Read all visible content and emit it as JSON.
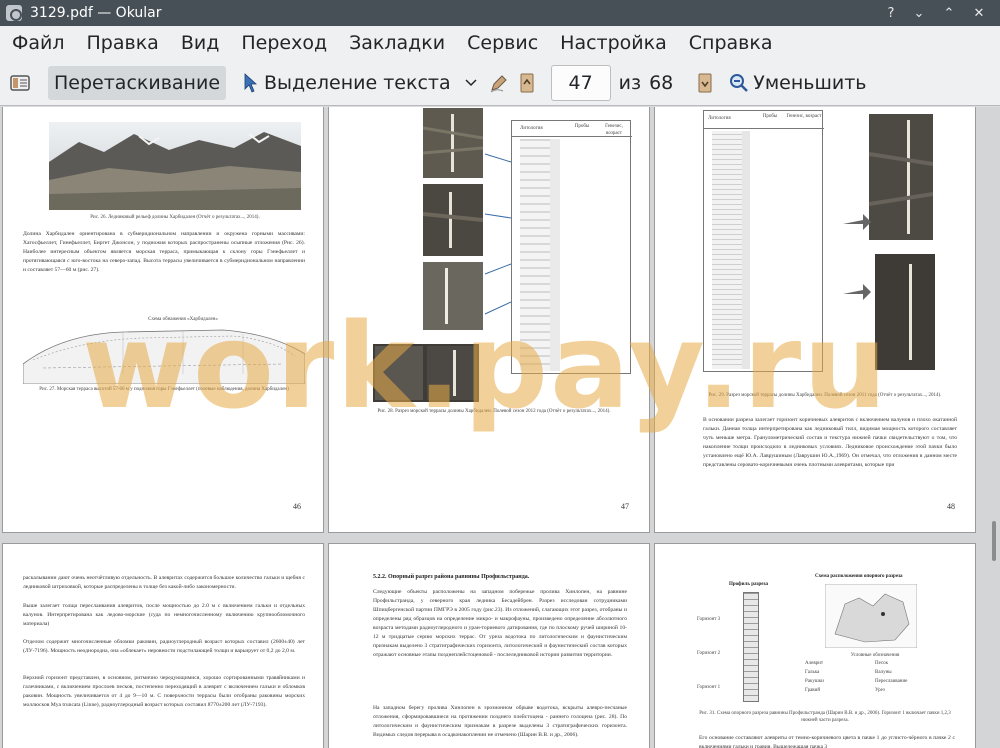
{
  "window": {
    "title": "3129.pdf — Okular",
    "controls": {
      "help": "?",
      "minimize": "⌄",
      "maximize": "⌃",
      "close": "✕"
    }
  },
  "menu": [
    "Файл",
    "Правка",
    "Вид",
    "Переход",
    "Закладки",
    "Сервис",
    "Настройка",
    "Справка"
  ],
  "toolbar": {
    "drag_label": "Перетаскивание",
    "select_label": "Выделение текста",
    "page_current": "47",
    "page_of": "из",
    "page_total": "68",
    "zoom_out_label": "Уменьшить"
  },
  "watermark": "work.pay.ru",
  "pages": {
    "p46": {
      "number": "46",
      "caption1": "Рис. 26. Ледниковый рельеф долины Харбидален (Отчёт о результатах..., 2014).",
      "body": "Долина Харбидален ориентирована в субмеридиональном направлении и окружена горными массивами: Хатосфьеллет, Гинефьеллет, Биргет Джонсон, у подножия которых распространены осыпные отложения (Рис. 26). Наиболее интересным объектом является морская терраса, примыкающая к склону горы Гэнефьеллет и протягивающаяся с юго-востока на северо-запад. Высота террасы увеличивается в субмеридиональном направлении и составляет 57—60 м (рис. 27).",
      "scheme_title": "Схема обнажения «Харбидален»",
      "caption2": "Рис. 27. Морская терраса высотой 57-60 м у подножия горы Гэнефьеллет (полевые наблюдения, долина Харбидален)"
    },
    "p47": {
      "number": "47",
      "col_lithology": "Литология",
      "col_samples": "Пробы",
      "col_genesis": "Генезис, возраст",
      "caption": "Рис. 28. Разрез морской террасы долины Харбидален. Полевой сезон 2012 года (Отчёт о результатах..., 2014)."
    },
    "p48": {
      "number": "48",
      "col_lithology": "Литология",
      "col_samples": "Пробы",
      "col_genesis": "Генезис, возраст",
      "caption": "Рис. 29. Разрез морской террасы долины Харбидален. Полевой сезон 2011 года (Отчёт о результатах..., 2014).",
      "body": "В основании разреза залегает горизонт коричневых алевритов с включением валунов и плохо окатанной гальки. Данная толща интерпретирована как ледниковый тилл, видимая мощность которого составляет чуть меньше метра. Гранулометрический состав и текстура нижней пачки свидетельствуют о том, что накопление толщи происходило в ледниковых условиях. Ледниковое происхождение этой пачки было установлено ещё Ю.А. Лаврушиным (Лаврушин Ю.А.,1969). Он отмечал, что отложения в данном месте представлены серовато-коричневыми очень плотными алевритами, которые при"
    },
    "p49": {
      "body1": "раскалывании дают очень неотчётливую отдельность. В алевритах содержится большое количество гальки и щебня с ледниковой штриховкой, которые распределены в толще без какой-либо закономерности.",
      "body2": "Выше залегает толща переслаивания алевритов, после мощностью до 2.0 м с включением гальки и отдельных валунов. Интерпретирована как ледово-морские (суда по немногочисленному включению крупнообломочного материала)",
      "body3": "Отделом содержит многочисленные обломки раковин, радиоуглеродный возраст которых составил (2600±40) лет (ЛУ-7196). Мощность неоднородна, она «облекает» неровности подстилающей толщи и варьирует от 0,2 до 2,0 м.",
      "body4": "Верхний горизонт представлен, в основном, ритмично чередующимися, хорошо сортированными травяйниками и галечниками, с включением прослоев песков, постепенно переходящий в алеврит с включением гальки и обломков раковин. Мощность увеличивается от 4 до 9—10 м. С поверхности террасы были отобраны раковины морских моллюсков Mya truncata (Linne), радиоуглеродный возраст которых составил 8770±200 лет (ЛУ-7193)."
    },
    "p50": {
      "heading": "5.2.2. Опорный разрез района равнины Профильстранда.",
      "body1": "Следующие объекты расположены на западном побережье пролива Хинлопен, на равнине Профильстранда, у северного края ледника Бесадейбрен. Разрез исследован сотрудниками Шпицбергенской партии ПМГРЭ в 2005 году (рис.23). Из отложений, слагающих этот разрез, отобраны и определены ряд образцов на определение микро- и макрофауны, произведено определение абсолютного возраста методами радиоуглеродного и уран-ториевого датирования, где по плоскому ручей шириной 10-12 м тридцатые серию морских террас. От уреза водотока по литологическим и фаунистическим признакам выделено 3 стратиграфических горизонта, литологический и фаунистический состав которых отражают основные этапы позднеплейстоценовой - послеледниковой истории развития территории.",
      "body2": "На западном берегу пролива Хинлопен в эрозионном обрыве водотока, вскрыты алевро-песчаные отложения, сформировавшиеся на протяжении позднего плейстоцена - раннего голоцена (рис. 28). По литологическим и фаунистическим признакам в разрезе выделены 3 стратиграфических горизонта. Видимых следов перерыва в осадконакоплении не отмечено (Шарин В.В. и др., 2006)."
    },
    "p51": {
      "title_left": "Профиль разреза",
      "title_right": "Схема расположения опорного разреза",
      "horizons": [
        "Горизонт 3",
        "Горизонт 2",
        "Горизонт 1"
      ],
      "legend_title": "Условные обозначения",
      "legend_items": [
        "Алеврит",
        "Песок",
        "Галька",
        "Валуны",
        "Ракушки",
        "Переслаивание",
        "Гравий",
        "Урез"
      ],
      "caption": "Рис. 31. Схема опорного разреза равнины Профильстранда (Шарин В.В. и др., 2006). Горизонт 1 включает пачки 1,2,3 нижней части разреза.",
      "body": "Его основание составляют алевриты от темно-коричневого цвета в пачке 1 до углисто-чёрного в пачке 2 с включениями гальки и гравия. Вышележащая пачка 3"
    }
  },
  "colors": {
    "titlebar": "#475057",
    "chrome": "#eff0f1",
    "active_button": "#d5d8db",
    "watermark": "#e6aa46"
  }
}
